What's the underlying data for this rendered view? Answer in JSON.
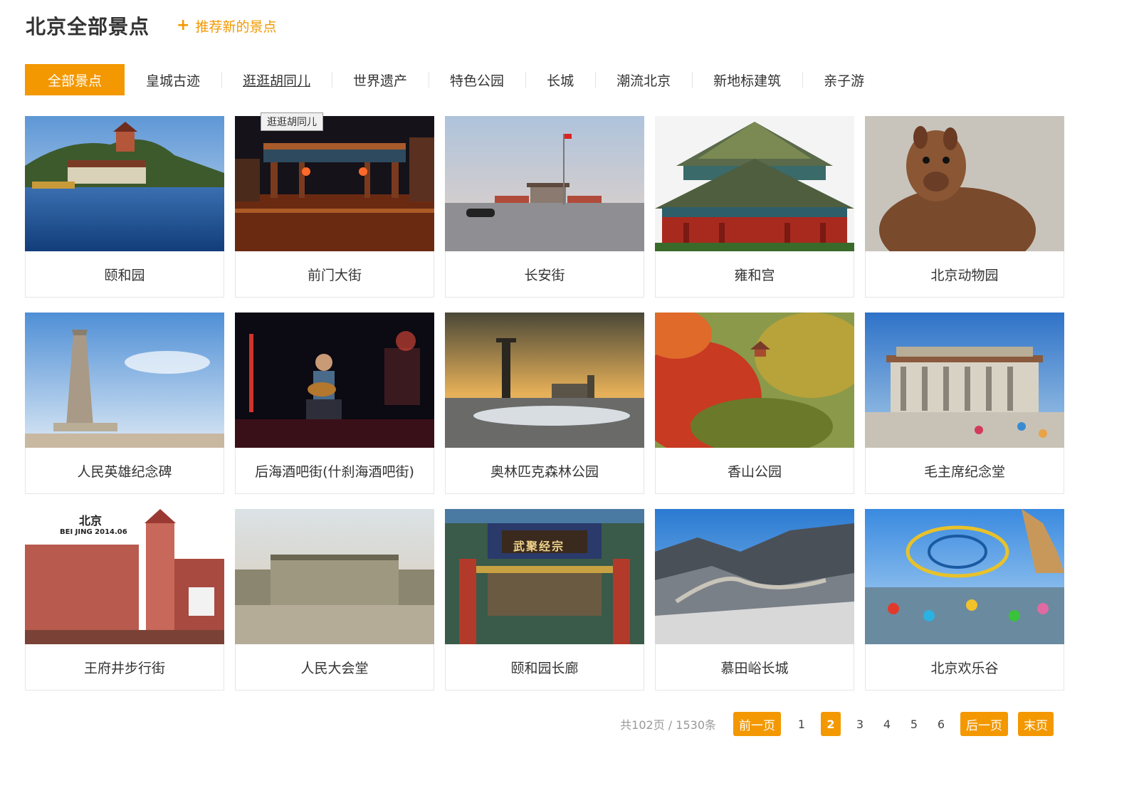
{
  "header": {
    "title": "北京全部景点",
    "recommend_icon": "plus-icon",
    "recommend_label": "推荐新的景点",
    "accent_color": "#f39800"
  },
  "tabs": [
    {
      "label": "全部景点",
      "active": true
    },
    {
      "label": "皇城古迹"
    },
    {
      "label": "逛逛胡同儿",
      "hovered": true
    },
    {
      "label": "世界遗产"
    },
    {
      "label": "特色公园"
    },
    {
      "label": "长城"
    },
    {
      "label": "潮流北京"
    },
    {
      "label": "新地标建筑"
    },
    {
      "label": "亲子游"
    }
  ],
  "attractions": [
    {
      "name": "颐和园",
      "scene": "lake-pavilion"
    },
    {
      "name": "前门大街",
      "scene": "night-street",
      "tooltip": "逛逛胡同儿"
    },
    {
      "name": "长安街",
      "scene": "square-dusk"
    },
    {
      "name": "雍和宫",
      "scene": "temple"
    },
    {
      "name": "北京动物园",
      "scene": "alpaca"
    },
    {
      "name": "人民英雄纪念碑",
      "scene": "monument"
    },
    {
      "name": "后海酒吧街(什刹海酒吧街)",
      "scene": "bar-stage"
    },
    {
      "name": "奥林匹克森林公园",
      "scene": "winter-sunset"
    },
    {
      "name": "香山公园",
      "scene": "autumn-hill"
    },
    {
      "name": "毛主席纪念堂",
      "scene": "memorial-hall"
    },
    {
      "name": "王府井步行街",
      "scene": "shopping-street",
      "overlay_text": [
        "北京",
        "BEI JING 2014.06"
      ]
    },
    {
      "name": "人民大会堂",
      "scene": "great-hall"
    },
    {
      "name": "颐和园长廊",
      "scene": "corridor",
      "overlay_text": [
        "武聚经宗"
      ]
    },
    {
      "name": "慕田峪长城",
      "scene": "great-wall"
    },
    {
      "name": "北京欢乐谷",
      "scene": "rollercoaster"
    }
  ],
  "pagination": {
    "summary": "共102页 / 1530条",
    "prev_label": "前一页",
    "pages": [
      "1",
      "2",
      "3",
      "4",
      "5",
      "6"
    ],
    "current": "2",
    "next_label": "后一页",
    "last_label": "末页"
  }
}
